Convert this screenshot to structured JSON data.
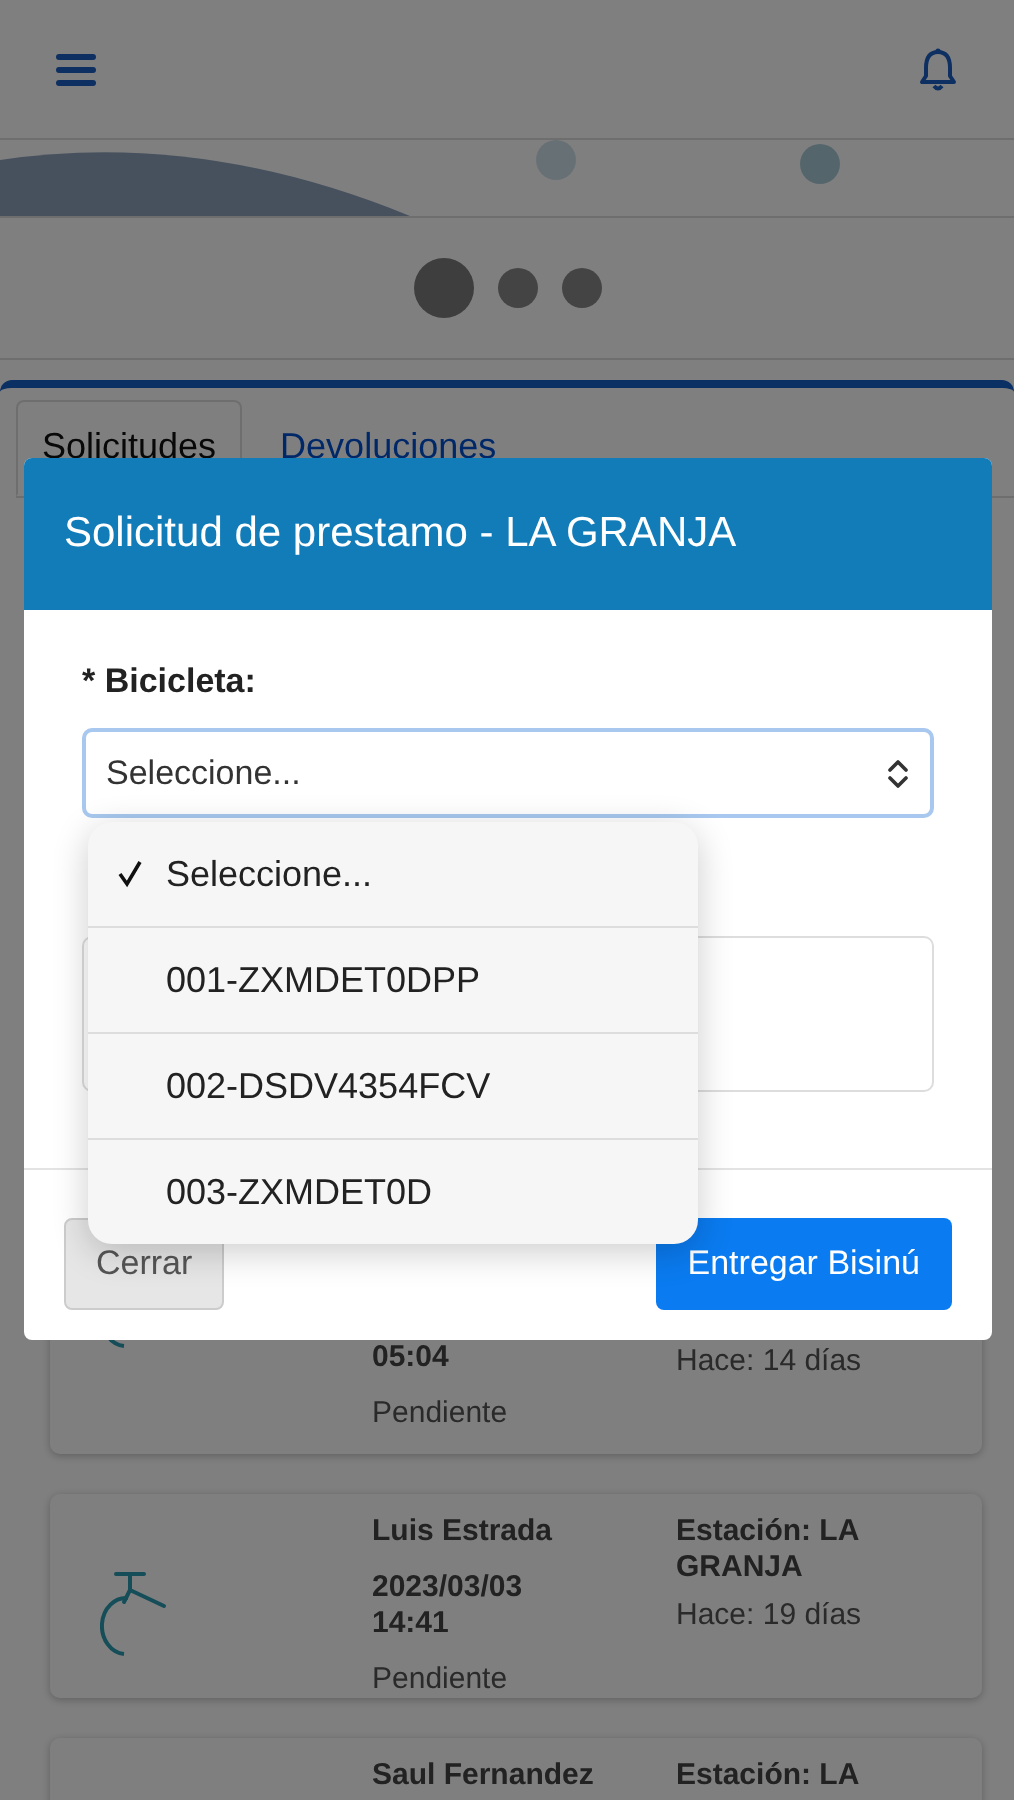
{
  "carousel": [
    {
      "selected": true
    },
    {
      "selected": false
    },
    {
      "selected": false
    }
  ],
  "tabs": [
    {
      "label": "Solicitudes",
      "selected": true
    },
    {
      "label": "Devoluciones",
      "selected": false
    }
  ],
  "requests": [
    {
      "date": "05:04",
      "ago": "Hace: 14 días",
      "status": "Pendiente"
    },
    {
      "name": "Luis Estrada",
      "date": "2023/03/03 14:41",
      "station": "Estación: LA GRANJA",
      "ago": "Hace: 19 días",
      "status": "Pendiente"
    },
    {
      "name": "Saul Fernandez",
      "station": "Estación: LA"
    }
  ],
  "modal": {
    "title": "Solicitud de prestamo - LA GRANJA",
    "field_label": "* Bicicleta:",
    "select_value": "Seleccione...",
    "dropdown": [
      {
        "label": "Seleccione...",
        "selected": true
      },
      {
        "label": "001-ZXMDET0DPP",
        "selected": false
      },
      {
        "label": "002-DSDV4354FCV",
        "selected": false
      },
      {
        "label": "003-ZXMDET0D",
        "selected": false
      }
    ],
    "buttons": [
      {
        "label": "Cerrar",
        "kind": "secondary"
      },
      {
        "label": "Entregar Bisinú",
        "kind": "primary"
      }
    ]
  }
}
